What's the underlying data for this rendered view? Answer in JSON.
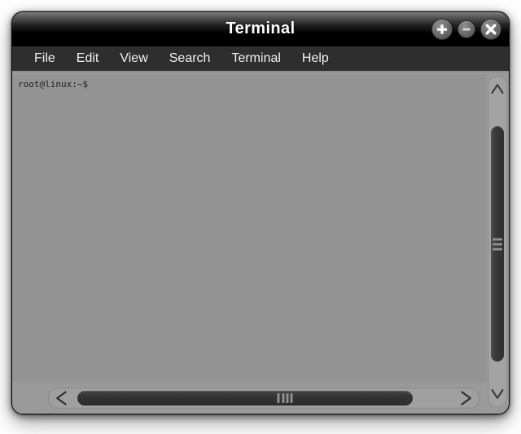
{
  "window": {
    "title": "Terminal",
    "controls": [
      {
        "name": "maximize-button",
        "icon": "plus-icon",
        "label": "+"
      },
      {
        "name": "minimize-button",
        "icon": "minus-icon",
        "label": "−"
      },
      {
        "name": "close-button",
        "icon": "close-icon",
        "label": "×"
      }
    ]
  },
  "menubar": {
    "items": [
      {
        "label": "File"
      },
      {
        "label": "Edit"
      },
      {
        "label": "View"
      },
      {
        "label": "Search"
      },
      {
        "label": "Terminal"
      },
      {
        "label": "Help"
      }
    ]
  },
  "terminal": {
    "prompt": "root@linux:~$",
    "background_color": "#949494",
    "text_color": "#1c1c1c"
  },
  "scrollbars": {
    "vertical": {
      "up_arrow_icon": "chevron-up-icon",
      "down_arrow_icon": "chevron-down-icon",
      "grip_icon": "grip-lines-icon"
    },
    "horizontal": {
      "left_arrow_icon": "chevron-left-icon",
      "right_arrow_icon": "chevron-right-icon",
      "grip_icon": "grip-lines-icon"
    }
  },
  "colors": {
    "titlebar": "#000000",
    "menubar": "#2e2e2e",
    "frame": "#9a9a9a",
    "scrollbar_thumb": "#333333"
  }
}
